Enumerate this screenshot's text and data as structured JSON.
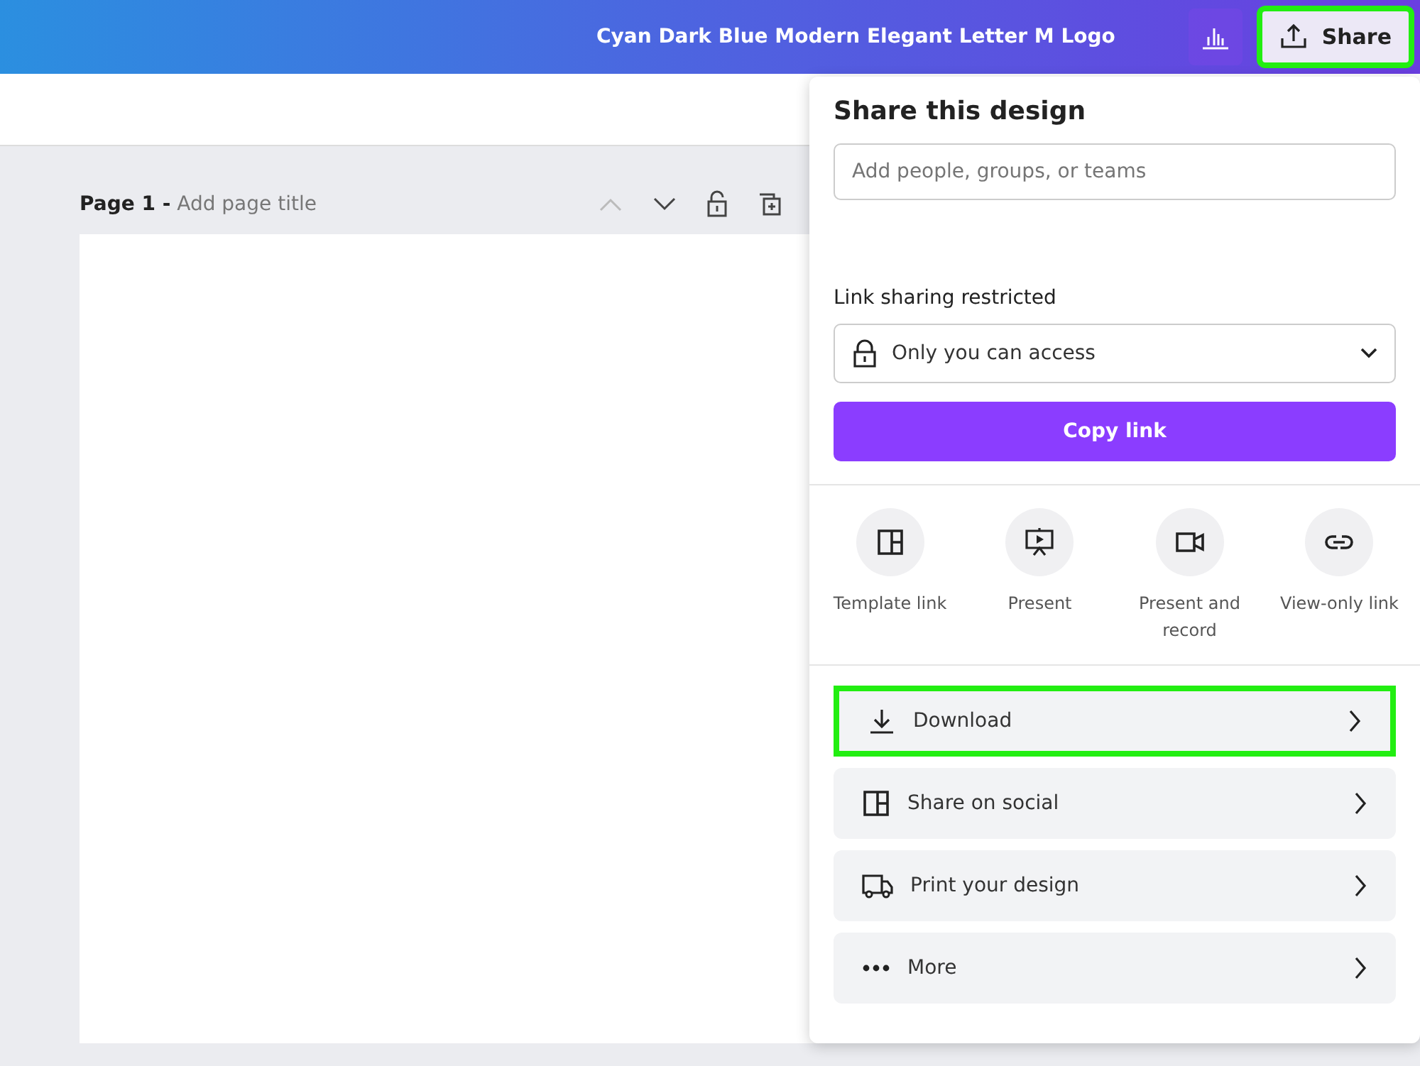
{
  "topbar": {
    "title": "Cyan Dark Blue Modern Elegant Letter M Logo",
    "share_button": {
      "label": "Share",
      "highlighted": true
    }
  },
  "page": {
    "number": "Page 1 -",
    "title_placeholder": "Add page title"
  },
  "share_panel": {
    "heading": "Share this design",
    "people_field": {
      "placeholder": "Add people, groups, or teams"
    },
    "link_label": "Link sharing restricted",
    "access_select": {
      "value": "Only you can access"
    },
    "copy_button": "Copy link",
    "quick_actions": [
      {
        "kind": "template",
        "label": "Template link"
      },
      {
        "kind": "present",
        "label": "Present"
      },
      {
        "kind": "record",
        "label": "Present and record"
      },
      {
        "kind": "link",
        "label": "View-only link"
      }
    ],
    "options": [
      {
        "kind": "download",
        "label": "Download",
        "highlighted": true
      },
      {
        "kind": "social",
        "label": "Share on social",
        "highlighted": false
      },
      {
        "kind": "print",
        "label": "Print your design",
        "highlighted": false
      },
      {
        "kind": "more",
        "label": "More",
        "highlighted": false
      }
    ]
  }
}
